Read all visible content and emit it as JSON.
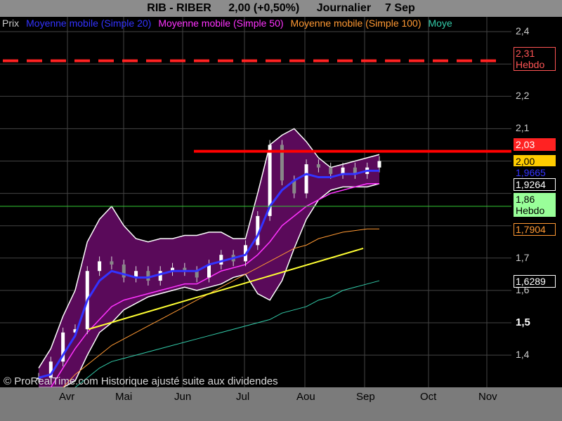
{
  "header": {
    "symbol": "RIB - RIBER",
    "quote": "2,00 (+0,50%)",
    "period": "Journalier",
    "date": "7 Sep"
  },
  "legend": [
    {
      "label": "Prix",
      "color": "#cccccc"
    },
    {
      "label": "Moyenne mobile (Simple 20)",
      "color": "#3333ff"
    },
    {
      "label": "Moyenne mobile (Simple 50)",
      "color": "#ff33ff"
    },
    {
      "label": "Moyenne mobile (Simple 100)",
      "color": "#ff9933"
    },
    {
      "label": "Moye",
      "color": "#33ccaa"
    }
  ],
  "price_tags": [
    {
      "value": "2,31",
      "sub": "Hebdo",
      "bg": "#000000",
      "fg": "#ff5555",
      "border": "#ff5555"
    },
    {
      "value": "2,03",
      "sub": "",
      "bg": "#ff2222",
      "fg": "#ffffff",
      "border": "#ff2222"
    },
    {
      "value": "2,00",
      "sub": "",
      "bg": "#ffcc00",
      "fg": "#000000",
      "border": "#ffcc00"
    },
    {
      "value": "1,9665",
      "sub": "",
      "bg": "#000000",
      "fg": "#3333ff",
      "border": "#000000"
    },
    {
      "value": "1,9264",
      "sub": "",
      "bg": "#000000",
      "fg": "#ffffff",
      "border": "#ffffff"
    },
    {
      "value": "1,86",
      "sub": "Hebdo",
      "bg": "#99ff99",
      "fg": "#000000",
      "border": "#99ff99"
    },
    {
      "value": "1,7904",
      "sub": "",
      "bg": "#000000",
      "fg": "#ff9933",
      "border": "#ff9933"
    },
    {
      "value": "1,6289",
      "sub": "",
      "bg": "#000000",
      "fg": "#ffffff",
      "border": "#ffffff"
    }
  ],
  "credit": "© ProRealTime.com Historique ajusté suite aux dividendes",
  "chart_data": {
    "type": "line",
    "x_labels": [
      "Avr",
      "Mai",
      "Jun",
      "Jul",
      "Aou",
      "Sep",
      "Oct",
      "Nov"
    ],
    "y_ticks": [
      "1,4",
      "1,5",
      "1,6",
      "1,7",
      "1,8",
      "1,9",
      "2",
      "2,1",
      "2,2",
      "2,3",
      "2,4"
    ],
    "y_tick_display": [
      "1,4",
      "1,5",
      "1,6",
      "1,7",
      "",
      "",
      "",
      "2,1",
      "2,2",
      "",
      "2,4"
    ],
    "ylim": [
      1.32,
      2.42
    ],
    "colors": {
      "price": "#ffffff",
      "sma20": "#3333ff",
      "sma50": "#ff33ff",
      "sma100": "#ff9933",
      "sma200": "#33ccaa",
      "bollinger_fill": "#5a0a5a",
      "bollinger_line": "#ffffff",
      "trendline": "#ffff33",
      "resistance": "#ff0000",
      "weekly_resistance": "#ff2222",
      "weekly_support": "#33cc33"
    },
    "horizontal_levels": [
      {
        "name": "weekly-resistance",
        "value": 2.31,
        "style": "dashed"
      },
      {
        "name": "resistance",
        "value": 2.03,
        "style": "solid"
      },
      {
        "name": "weekly-support",
        "value": 1.86,
        "style": "solid"
      }
    ],
    "trendline": {
      "from": {
        "x": "Avr",
        "y": 1.48
      },
      "to": {
        "x": "Aou",
        "y": 1.73
      }
    },
    "series": [
      {
        "key": "price",
        "values": [
          1.33,
          1.38,
          1.47,
          1.48,
          1.66,
          1.69,
          1.68,
          1.64,
          1.66,
          1.63,
          1.66,
          1.67,
          1.66,
          1.64,
          1.68,
          1.71,
          1.69,
          1.74,
          1.83,
          2.05,
          1.94,
          1.9,
          1.99,
          1.98,
          1.96,
          1.98,
          1.96,
          1.98,
          2.0
        ]
      },
      {
        "key": "sma20",
        "values": [
          1.33,
          1.34,
          1.4,
          1.46,
          1.57,
          1.63,
          1.66,
          1.65,
          1.64,
          1.64,
          1.65,
          1.66,
          1.66,
          1.66,
          1.68,
          1.69,
          1.7,
          1.71,
          1.77,
          1.86,
          1.91,
          1.94,
          1.96,
          1.95,
          1.95,
          1.96,
          1.96,
          1.97,
          1.97
        ]
      },
      {
        "key": "sma50",
        "values": [
          1.28,
          1.3,
          1.36,
          1.42,
          1.47,
          1.51,
          1.55,
          1.57,
          1.58,
          1.59,
          1.6,
          1.61,
          1.62,
          1.62,
          1.64,
          1.66,
          1.67,
          1.68,
          1.71,
          1.75,
          1.8,
          1.83,
          1.86,
          1.88,
          1.9,
          1.91,
          1.92,
          1.93,
          1.93
        ]
      },
      {
        "key": "sma100",
        "values": [
          1.25,
          1.27,
          1.3,
          1.34,
          1.37,
          1.4,
          1.43,
          1.45,
          1.47,
          1.49,
          1.51,
          1.53,
          1.55,
          1.57,
          1.59,
          1.61,
          1.63,
          1.65,
          1.67,
          1.69,
          1.71,
          1.73,
          1.74,
          1.76,
          1.77,
          1.78,
          1.785,
          1.79,
          1.79
        ]
      },
      {
        "key": "sma200",
        "values": [
          1.25,
          1.26,
          1.28,
          1.3,
          1.33,
          1.36,
          1.38,
          1.39,
          1.4,
          1.41,
          1.42,
          1.43,
          1.44,
          1.45,
          1.46,
          1.47,
          1.48,
          1.49,
          1.5,
          1.51,
          1.53,
          1.54,
          1.55,
          1.57,
          1.58,
          1.6,
          1.61,
          1.62,
          1.63
        ]
      },
      {
        "key": "boll_upper",
        "values": [
          1.36,
          1.42,
          1.52,
          1.6,
          1.75,
          1.82,
          1.86,
          1.8,
          1.76,
          1.75,
          1.76,
          1.76,
          1.77,
          1.77,
          1.78,
          1.78,
          1.76,
          1.76,
          1.9,
          2.05,
          2.08,
          2.1,
          2.06,
          2.01,
          1.98,
          1.99,
          2.0,
          2.01,
          2.02
        ]
      },
      {
        "key": "boll_lower",
        "values": [
          1.3,
          1.3,
          1.3,
          1.32,
          1.4,
          1.47,
          1.5,
          1.54,
          1.56,
          1.58,
          1.59,
          1.6,
          1.61,
          1.6,
          1.61,
          1.62,
          1.64,
          1.65,
          1.59,
          1.57,
          1.63,
          1.73,
          1.82,
          1.88,
          1.91,
          1.92,
          1.92,
          1.92,
          1.93
        ]
      }
    ]
  }
}
